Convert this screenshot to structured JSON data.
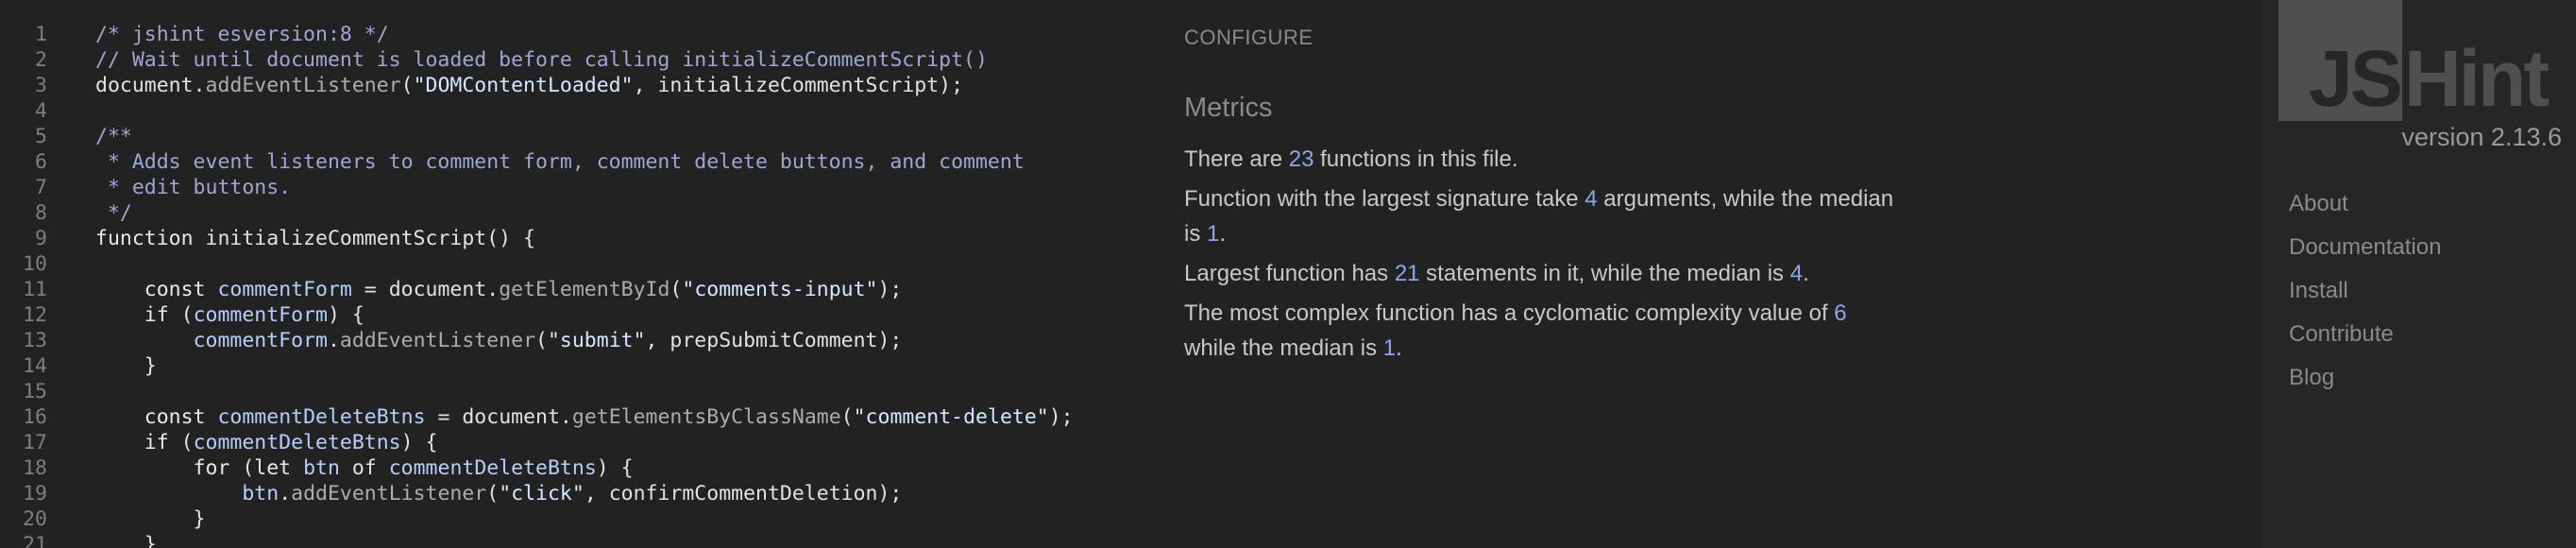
{
  "editor": {
    "line_numbers": [
      "1",
      "2",
      "3",
      "4",
      "5",
      "6",
      "7",
      "8",
      "9",
      "10",
      "11",
      "12",
      "13",
      "14",
      "15",
      "16",
      "17",
      "18",
      "19",
      "20",
      "21"
    ],
    "lines": [
      [
        {
          "t": "c",
          "v": "/* jshint esversion:8 */"
        }
      ],
      [
        {
          "t": "c",
          "v": "// Wait until document is loaded before calling initializeCommentScript()"
        }
      ],
      [
        {
          "t": "p",
          "v": "document."
        },
        {
          "t": "m",
          "v": "addEventListener"
        },
        {
          "t": "p",
          "v": "("
        },
        {
          "t": "s",
          "v": "\"DOMContentLoaded\""
        },
        {
          "t": "p",
          "v": ", initializeCommentScript);"
        }
      ],
      [],
      [
        {
          "t": "c",
          "v": "/**"
        }
      ],
      [
        {
          "t": "c",
          "v": " * Adds event listeners to comment form, comment delete buttons, and comment"
        }
      ],
      [
        {
          "t": "c",
          "v": " * edit buttons."
        }
      ],
      [
        {
          "t": "c",
          "v": " */"
        }
      ],
      [
        {
          "t": "k",
          "v": "function"
        },
        {
          "t": "p",
          "v": " initializeCommentScript() {"
        }
      ],
      [],
      [
        {
          "t": "p",
          "v": "    "
        },
        {
          "t": "k",
          "v": "const"
        },
        {
          "t": "p",
          "v": " "
        },
        {
          "t": "v",
          "v": "commentForm"
        },
        {
          "t": "p",
          "v": " = document."
        },
        {
          "t": "m",
          "v": "getElementById"
        },
        {
          "t": "p",
          "v": "("
        },
        {
          "t": "s",
          "v": "\"comments-input\""
        },
        {
          "t": "p",
          "v": ");"
        }
      ],
      [
        {
          "t": "p",
          "v": "    "
        },
        {
          "t": "k",
          "v": "if"
        },
        {
          "t": "p",
          "v": " ("
        },
        {
          "t": "v",
          "v": "commentForm"
        },
        {
          "t": "p",
          "v": ") {"
        }
      ],
      [
        {
          "t": "p",
          "v": "        "
        },
        {
          "t": "v",
          "v": "commentForm"
        },
        {
          "t": "p",
          "v": "."
        },
        {
          "t": "m",
          "v": "addEventListener"
        },
        {
          "t": "p",
          "v": "("
        },
        {
          "t": "s",
          "v": "\"submit\""
        },
        {
          "t": "p",
          "v": ", prepSubmitComment);"
        }
      ],
      [
        {
          "t": "p",
          "v": "    }"
        }
      ],
      [],
      [
        {
          "t": "p",
          "v": "    "
        },
        {
          "t": "k",
          "v": "const"
        },
        {
          "t": "p",
          "v": " "
        },
        {
          "t": "v",
          "v": "commentDeleteBtns"
        },
        {
          "t": "p",
          "v": " = document."
        },
        {
          "t": "m",
          "v": "getElementsByClassName"
        },
        {
          "t": "p",
          "v": "("
        },
        {
          "t": "s",
          "v": "\"comment-delete\""
        },
        {
          "t": "p",
          "v": ");"
        }
      ],
      [
        {
          "t": "p",
          "v": "    "
        },
        {
          "t": "k",
          "v": "if"
        },
        {
          "t": "p",
          "v": " ("
        },
        {
          "t": "v",
          "v": "commentDeleteBtns"
        },
        {
          "t": "p",
          "v": ") {"
        }
      ],
      [
        {
          "t": "p",
          "v": "        "
        },
        {
          "t": "k",
          "v": "for"
        },
        {
          "t": "p",
          "v": " ("
        },
        {
          "t": "k",
          "v": "let"
        },
        {
          "t": "p",
          "v": " "
        },
        {
          "t": "v",
          "v": "btn"
        },
        {
          "t": "p",
          "v": " of "
        },
        {
          "t": "v",
          "v": "commentDeleteBtns"
        },
        {
          "t": "p",
          "v": ") {"
        }
      ],
      [
        {
          "t": "p",
          "v": "            "
        },
        {
          "t": "v",
          "v": "btn"
        },
        {
          "t": "p",
          "v": "."
        },
        {
          "t": "m",
          "v": "addEventListener"
        },
        {
          "t": "p",
          "v": "("
        },
        {
          "t": "s",
          "v": "\"click\""
        },
        {
          "t": "p",
          "v": ", confirmCommentDeletion);"
        }
      ],
      [
        {
          "t": "p",
          "v": "        }"
        }
      ],
      [
        {
          "t": "p",
          "v": "    }"
        }
      ]
    ]
  },
  "report": {
    "configure_label": "CONFIGURE",
    "metrics_heading": "Metrics",
    "metrics": {
      "p1_pre": "There are ",
      "function_count": "23",
      "p1_post": " functions in this file.",
      "p2_pre": "Function with the largest signature take ",
      "largest_signature": "4",
      "p2_mid": " arguments, while the median is ",
      "signature_median": "1",
      "p2_post": ".",
      "p3_pre": "Largest function has ",
      "largest_statements": "21",
      "p3_mid": " statements in it, while the median is ",
      "statements_median": "4",
      "p3_post": ".",
      "p4_pre": "The most complex function has a cyclomatic complexity value of ",
      "max_complexity": "6",
      "p4_mid": " while the median is ",
      "complexity_median": "1",
      "p4_post": "."
    }
  },
  "sidebar": {
    "logo_js": "JS",
    "logo_hint": "Hint",
    "version": "version 2.13.6",
    "nav": [
      {
        "label": "About"
      },
      {
        "label": "Documentation"
      },
      {
        "label": "Install"
      },
      {
        "label": "Contribute"
      },
      {
        "label": "Blog"
      }
    ]
  },
  "colors": {
    "background": "#222222",
    "sidebar_background": "#262626",
    "logo_gray": "#4f4f4f",
    "metric_number": "#8fa6e8",
    "comment": "#9fa7d0"
  }
}
